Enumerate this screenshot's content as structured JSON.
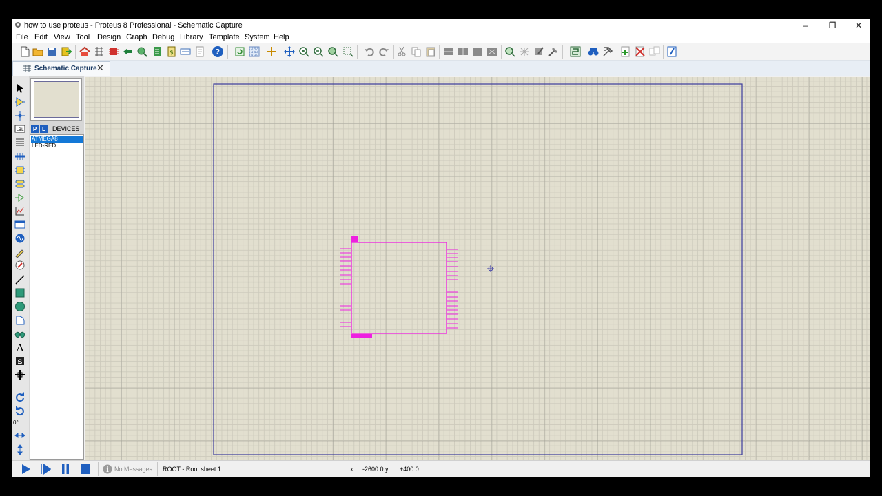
{
  "window": {
    "title": "how to use proteus - Proteus 8 Professional - Schematic Capture",
    "controls": {
      "minimize": "–",
      "maximize": "❐",
      "close": "✕"
    }
  },
  "menu": [
    "File",
    "Edit",
    "View",
    "Tool",
    "Design",
    "Graph",
    "Debug",
    "Library",
    "Template",
    "System",
    "Help"
  ],
  "toolbar": {
    "icons": [
      "new-file-icon",
      "open-folder-icon",
      "save-icon",
      "import-icon",
      "home-icon",
      "schematic-icon",
      "pcb-icon",
      "gerber-icon",
      "3d-visualizer-icon",
      "bom-icon",
      "design-explorer-icon",
      "code-icon",
      "help-icon",
      "refresh-icon",
      "grid-toggle-icon",
      "origin-icon",
      "pan-icon",
      "zoom-in-icon",
      "zoom-out-icon",
      "zoom-all-icon",
      "zoom-area-icon",
      "undo-icon",
      "redo-icon",
      "cut-icon",
      "copy-icon",
      "paste-icon",
      "block-copy-icon",
      "block-move-icon",
      "block-rotate-icon",
      "block-delete-icon",
      "pick-device-icon",
      "make-device-icon",
      "packaging-tool-icon",
      "decompose-icon",
      "wire-autorouter-icon",
      "search-tag-icon",
      "property-assignment-icon",
      "new-sheet-icon",
      "remove-sheet-icon",
      "goto-sheet-icon",
      "design-notes-icon"
    ]
  },
  "tab": {
    "label": "Schematic Capture",
    "close": "✕"
  },
  "left_tools": [
    "select-icon",
    "component-icon",
    "junction-icon",
    "wire-label-icon",
    "text-script-icon",
    "bus-icon",
    "subcircuit-icon",
    "terminal-icon",
    "device-pin-icon",
    "graph-icon",
    "tape-recorder-icon",
    "generator-icon",
    "voltage-probe-icon",
    "current-probe-icon",
    "line-icon",
    "box-icon",
    "circle-icon",
    "arc-icon",
    "path-icon",
    "text-icon",
    "symbol-icon",
    "marker-icon",
    "rotate-cw-icon",
    "rotate-ccw-icon",
    "mirror-x-icon",
    "mirror-y-icon"
  ],
  "rotation_angle": "0°",
  "device_panel": {
    "p_button": "P",
    "l_button": "L",
    "header": "DEVICES",
    "items": [
      {
        "label": "ATMEGA8",
        "selected": true
      },
      {
        "label": "LED-RED",
        "selected": false
      }
    ]
  },
  "colors": {
    "component": "#ee20e0",
    "sheet_border": "#3b3b9c",
    "grid_bg": "#e2dfcf",
    "selection": "#1378d7"
  },
  "status": {
    "messages_icon": "info-icon",
    "messages": "No Messages",
    "sheet": "ROOT - Root sheet 1",
    "x_label": "x:",
    "x_value": "-2600.0",
    "y_label": "y:",
    "y_value": "+400.0"
  }
}
